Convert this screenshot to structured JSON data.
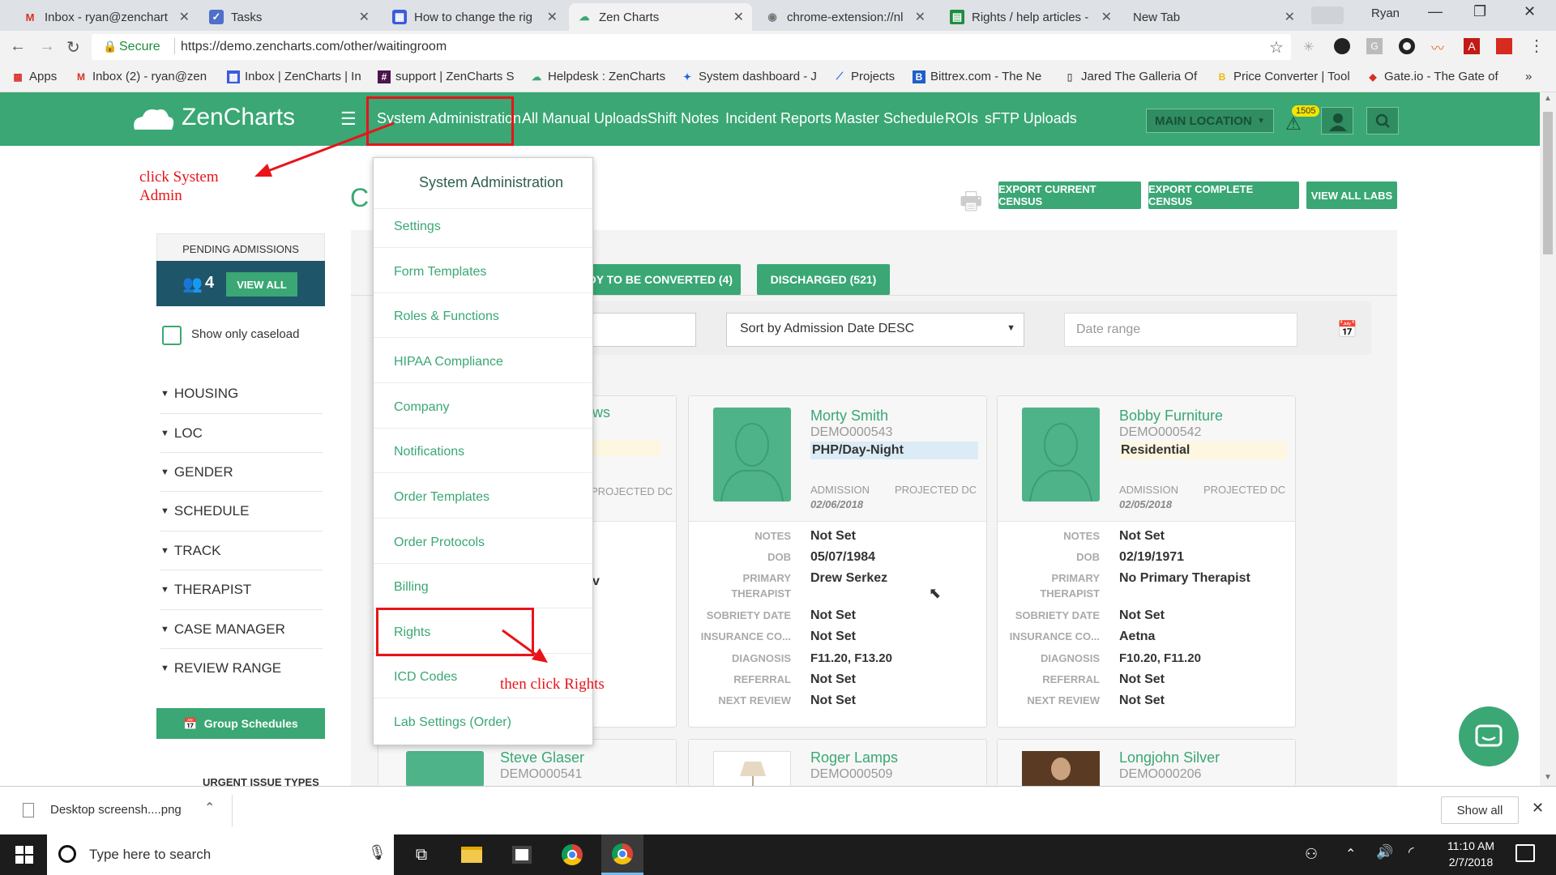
{
  "browser": {
    "tabs": [
      {
        "title": "Inbox - ryan@zenchart",
        "icon": "gmail-icon"
      },
      {
        "title": "Tasks",
        "icon": "tasks-icon"
      },
      {
        "title": "How to change the rig",
        "icon": "article-icon"
      },
      {
        "title": "Zen Charts",
        "icon": "zencharts-icon",
        "active": true
      },
      {
        "title": "chrome-extension://nl",
        "icon": "extension-icon"
      },
      {
        "title": "Rights / help articles -",
        "icon": "sheets-icon"
      },
      {
        "title": "New Tab",
        "icon": ""
      }
    ],
    "user": "Ryan",
    "secure_label": "Secure",
    "url": "https://demo.zencharts.com/other/waitingroom",
    "bookmarks": [
      "Apps",
      "Inbox (2) - ryan@zen",
      "Inbox | ZenCharts | In",
      "support | ZenCharts S",
      "Helpdesk : ZenCharts",
      "System dashboard - J",
      "Projects",
      "Bittrex.com - The Ne",
      "Jared The Galleria Of",
      "Price Converter | Tool",
      "Gate.io - The Gate of"
    ],
    "bookmarks_more": "»"
  },
  "app": {
    "logo": "ZenCharts",
    "nav": [
      "System Administration",
      "All Manual Uploads",
      "Shift Notes",
      "Incident Reports",
      "Master Schedule",
      "ROIs",
      "sFTP Uploads"
    ],
    "location": "MAIN LOCATION",
    "alert_count": "1505"
  },
  "menu": {
    "title": "System Administration",
    "items": [
      "Settings",
      "Form Templates",
      "Roles & Functions",
      "HIPAA Compliance",
      "Company",
      "Notifications",
      "Order Templates",
      "Order Protocols",
      "Billing",
      "Rights",
      "ICD Codes",
      "Lab Settings (Order)"
    ]
  },
  "annotations": {
    "click_system": "click System",
    "admin": "Admin",
    "then_click": "then click Rights"
  },
  "sidebar": {
    "pending_label": "PENDING ADMISSIONS",
    "pending_count": "4",
    "view_all": "VIEW ALL",
    "caseload": "Show only caseload",
    "filters": [
      "HOUSING",
      "LOC",
      "GENDER",
      "SCHEDULE",
      "TRACK",
      "THERAPIST",
      "CASE MANAGER",
      "REVIEW RANGE"
    ],
    "group_schedules": "Group Schedules",
    "urgent": "URGENT ISSUE TYPES"
  },
  "page": {
    "title_letter": "C",
    "exports": [
      "EXPORT CURRENT CENSUS",
      "EXPORT COMPLETE CENSUS",
      "VIEW ALL LABS"
    ],
    "tab_ready": "DY TO BE CONVERTED (4)",
    "tab_discharged": "DISCHARGED (521)",
    "sort": "Sort by Admission Date DESC",
    "date_placeholder": "Date range"
  },
  "cards": [
    {
      "name": "Morty Smith",
      "id": "DEMO000543",
      "type": "PHP/Day-Night",
      "type_color": "#dbecf6",
      "admission": "02/06/2018",
      "notes": "Not Set",
      "dob": "05/07/1984",
      "therapist": "Drew Serkez",
      "sobriety": "Not Set",
      "insurance": "Not Set",
      "diagnosis": "F11.20, F13.20",
      "referral": "Not Set",
      "next_review": "Not Set"
    },
    {
      "name": "Bobby Furniture",
      "id": "DEMO000542",
      "type": "Residential",
      "type_color": "#fdf7e1",
      "admission": "02/05/2018",
      "notes": "Not Set",
      "dob": "02/19/1971",
      "therapist": "No Primary Therapist",
      "sobriety": "Not Set",
      "insurance": "Aetna",
      "diagnosis": "F10.20, F11.20",
      "referral": "Not Set",
      "next_review": "Not Set"
    }
  ],
  "partial_card": {
    "name_tail": "ws",
    "projected": "PROJECTED DC",
    "row_tail": "v"
  },
  "card_labels": {
    "admission": "ADMISSION",
    "projected": "PROJECTED DC",
    "notes": "NOTES",
    "dob": "DOB",
    "therapist1": "PRIMARY",
    "therapist2": "THERAPIST",
    "sobriety": "SOBRIETY DATE",
    "insurance": "INSURANCE CO...",
    "diagnosis": "DIAGNOSIS",
    "referral": "REFERRAL",
    "next_review": "NEXT REVIEW"
  },
  "bottom_cards": [
    {
      "name": "Steve Glaser",
      "id": "DEMO000541"
    },
    {
      "name": "Roger Lamps",
      "id": "DEMO000509"
    },
    {
      "name": "Longjohn Silver",
      "id": "DEMO000206"
    }
  ],
  "download": {
    "file": "Desktop screensh....png",
    "show_all": "Show all"
  },
  "taskbar": {
    "search": "Type here to search",
    "time": "11:10 AM",
    "date": "2/7/2018"
  }
}
